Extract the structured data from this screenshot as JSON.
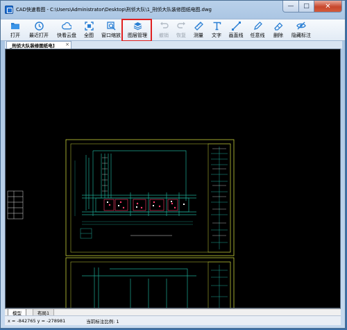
{
  "window": {
    "title": "CAD快速看图 - C:\\Users\\Administrator\\Desktop\\刑侦大队\\1_刑侦大队装修图纸电图.dwg",
    "controls": {
      "minimize": "—",
      "maximize": "□",
      "close": "✕"
    }
  },
  "toolbar": {
    "buttons": [
      {
        "label": "打开",
        "icon": "folder-icon",
        "enabled": true
      },
      {
        "label": "最近打开",
        "icon": "clock-icon",
        "enabled": true
      },
      {
        "label": "快看云盘",
        "icon": "cloud-icon",
        "enabled": true
      },
      {
        "label": "全图",
        "icon": "fit-extent-icon",
        "enabled": true
      },
      {
        "label": "窗口缩放",
        "icon": "zoom-window-icon",
        "enabled": true
      },
      {
        "label": "图层管理",
        "icon": "layers-icon",
        "enabled": true
      },
      {
        "label": "撤销",
        "icon": "undo-icon",
        "enabled": false
      },
      {
        "label": "恢复",
        "icon": "redo-icon",
        "enabled": false
      },
      {
        "label": "测量",
        "icon": "measure-icon",
        "enabled": true
      },
      {
        "label": "文字",
        "icon": "text-icon",
        "enabled": true
      },
      {
        "label": "画直线",
        "icon": "line-icon",
        "enabled": true
      },
      {
        "label": "任意线",
        "icon": "pencil-icon",
        "enabled": true
      },
      {
        "label": "删除",
        "icon": "eraser-icon",
        "enabled": true
      },
      {
        "label": "隐藏标注",
        "icon": "eye-off-icon",
        "enabled": true
      }
    ]
  },
  "document_tab": {
    "label": "_刑侦大队装修图纸电]",
    "close": "×"
  },
  "layout_tabs": {
    "model": "模型",
    "layout1": "布局1"
  },
  "status": {
    "coordinates": "x = -842765  y = -278981",
    "scale": "当前标注比例: 1"
  },
  "colors": {
    "canvas_background": "#000000",
    "drawing_frame": "#c8d23a",
    "walls": "#1eaa96",
    "highlight": "#e02020",
    "detail": "#ff3b6b"
  }
}
